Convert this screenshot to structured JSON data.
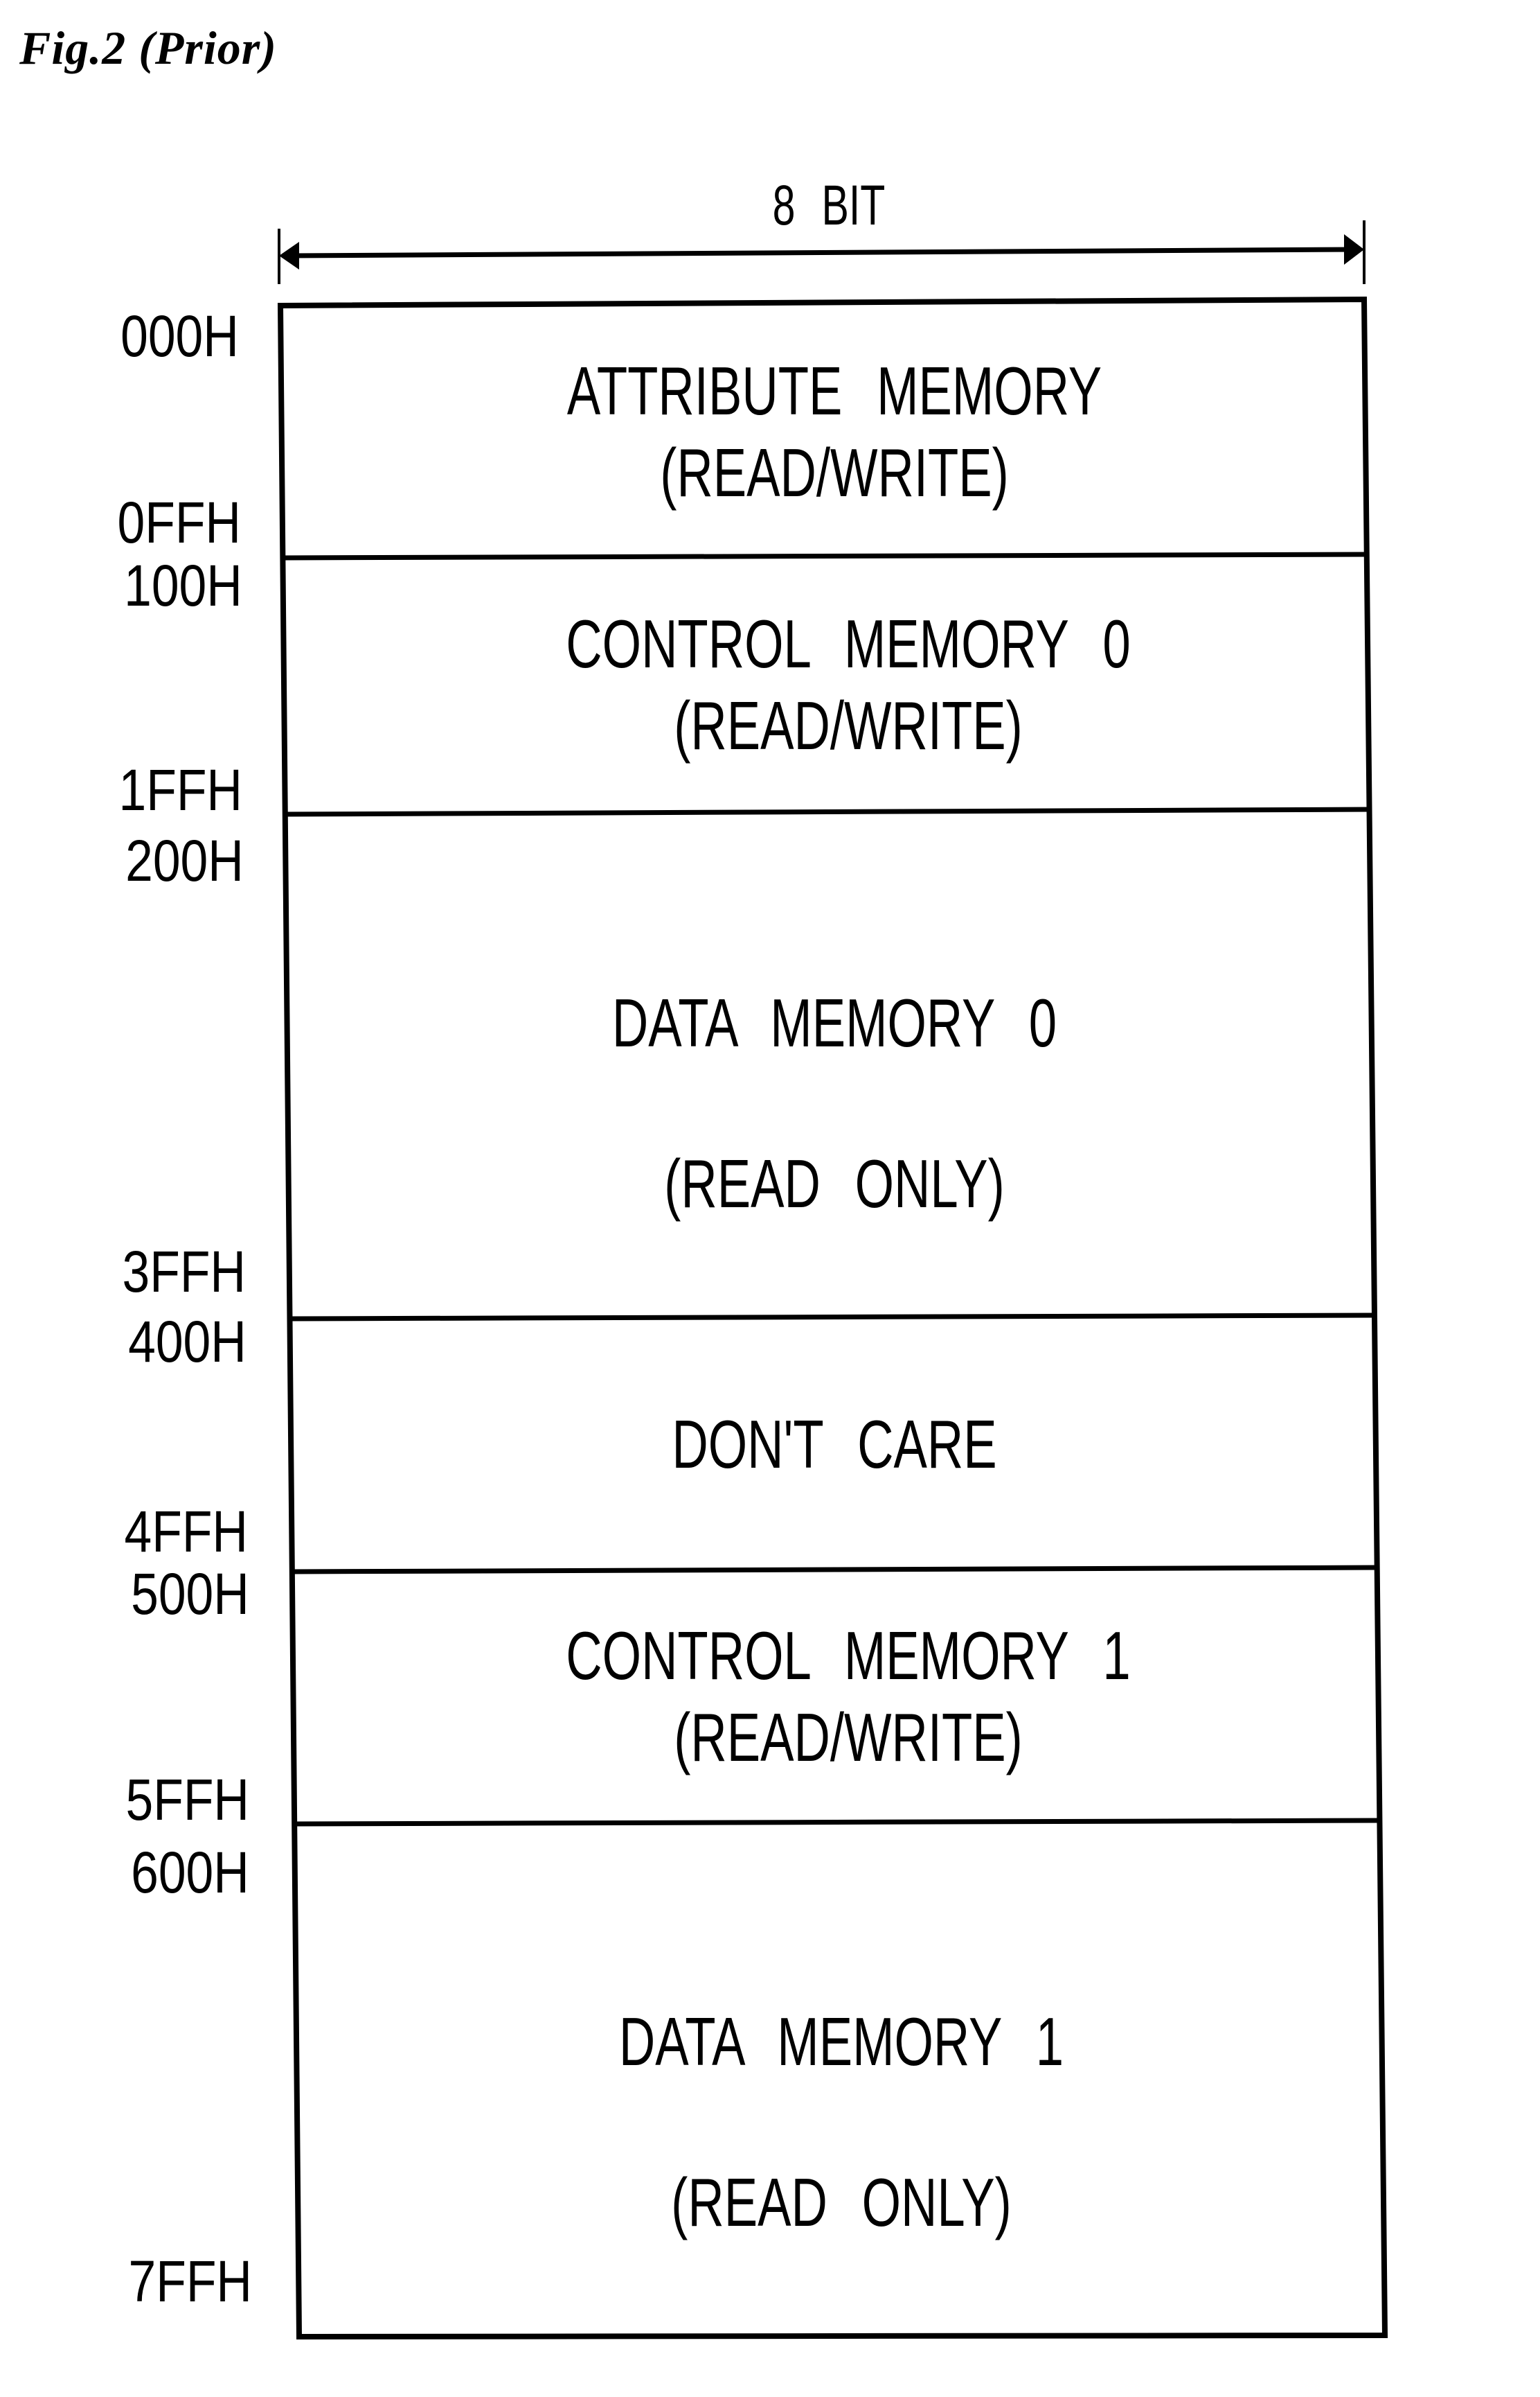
{
  "figure": {
    "title": "Fig.2 (Prior)",
    "width_label": "8 BIT"
  },
  "segments": [
    {
      "name": "ATTRIBUTE MEMORY",
      "access": "(READ/WRITE)",
      "start": "000H",
      "end": "0FFH"
    },
    {
      "name": "CONTROL MEMORY 0",
      "access": "(READ/WRITE)",
      "start": "100H",
      "end": "1FFH"
    },
    {
      "name": "DATA MEMORY 0",
      "access": "(READ ONLY)",
      "start": "200H",
      "end": "3FFH"
    },
    {
      "name": "DON'T CARE",
      "access": "",
      "start": "400H",
      "end": "4FFH"
    },
    {
      "name": "CONTROL MEMORY 1",
      "access": "(READ/WRITE)",
      "start": "500H",
      "end": "5FFH"
    },
    {
      "name": "DATA MEMORY 1",
      "access": "(READ ONLY)",
      "start": "600H",
      "end": "7FFH"
    }
  ]
}
